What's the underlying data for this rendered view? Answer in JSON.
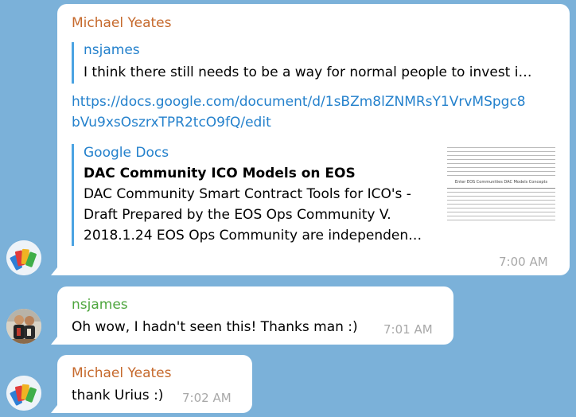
{
  "colors": {
    "background": "#7bb1d9",
    "sender_orange": "#c6692c",
    "sender_green": "#4ea63e",
    "link_blue": "#2481cc",
    "quote_bar": "#4ba3e2"
  },
  "messages": [
    {
      "sender": "Michael Yeates",
      "reply": {
        "author": "nsjames",
        "text": "I think there still needs to be a way for normal people to invest i…"
      },
      "link_line1": "https://docs.google.com/document/d/1sBZm8lZNMRsY1VrvMSpgc8",
      "link_line2": "bVu9xsOszrxTPR2tcO9fQ/edit",
      "preview": {
        "site": "Google Docs",
        "title": "DAC Community ICO Models on EOS",
        "desc_line1": "DAC Community Smart Contract Tools for ICO's -",
        "desc_line2": "Draft  Prepared by the EOS Ops Community V.",
        "desc_line3": "2018.1.24 EOS Ops Community are independen…",
        "thumbnail_heading": "Enter EOS Communities DAC Models Concepts"
      },
      "time": "7:00 AM",
      "avatar_icon": "colorful-tags-avatar-icon"
    },
    {
      "sender": "nsjames",
      "text": "Oh wow, I hadn't seen this! Thanks man :)",
      "time": "7:01 AM",
      "avatar_icon": "person-photo-avatar-icon"
    },
    {
      "sender": "Michael Yeates",
      "text": "thank Urius :)",
      "time": "7:02 AM",
      "avatar_icon": "colorful-tags-avatar-icon"
    }
  ]
}
